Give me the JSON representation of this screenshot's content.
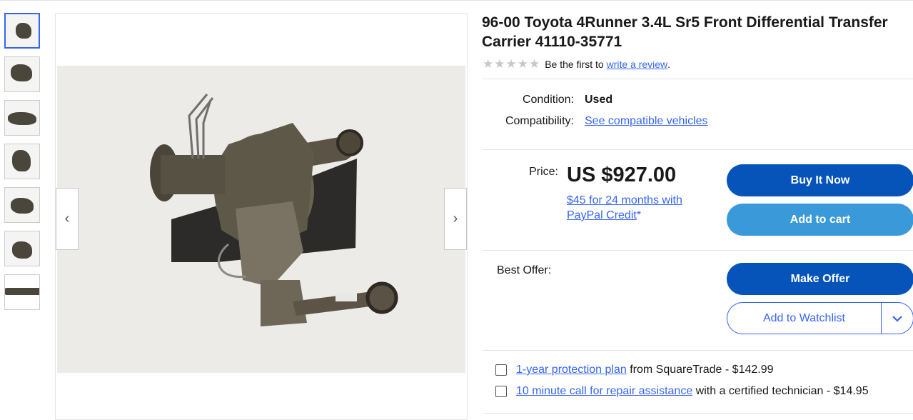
{
  "listing": {
    "title": "96-00 Toyota 4Runner 3.4L Sr5 Front Differential Transfer Carrier 41110-35771",
    "rating_prefix": "Be the first to ",
    "rating_link": "write a review",
    "rating_suffix": ".",
    "stars_filled": 0,
    "stars_total": 5
  },
  "details": {
    "condition_label": "Condition:",
    "condition_value": "Used",
    "compat_label": "Compatibility:",
    "compat_link": "See compatible vehicles"
  },
  "pricing": {
    "price_label": "Price:",
    "price_value": "US $927.00",
    "credit_link": "$45 for 24 months with PayPal Credit",
    "credit_suffix": "*",
    "best_offer_label": "Best Offer:"
  },
  "actions": {
    "buy_now": "Buy It Now",
    "add_to_cart": "Add to cart",
    "make_offer": "Make Offer",
    "add_to_watchlist": "Add to Watchlist"
  },
  "addons": [
    {
      "link": "1-year protection plan",
      "text": " from SquareTrade - $142.99"
    },
    {
      "link": "10 minute call for repair assistance",
      "text": " with a certified technician - $14.95"
    }
  ],
  "gallery": {
    "thumbnail_count": 7,
    "active_index": 0
  },
  "colors": {
    "primary_button": "#0654ba",
    "secondary_button": "#3a9ad9",
    "link": "#3665f3"
  },
  "icons": {
    "prev": "chevron-left-icon",
    "next": "chevron-right-icon",
    "dropdown": "chevron-down-icon",
    "star": "star-icon"
  }
}
